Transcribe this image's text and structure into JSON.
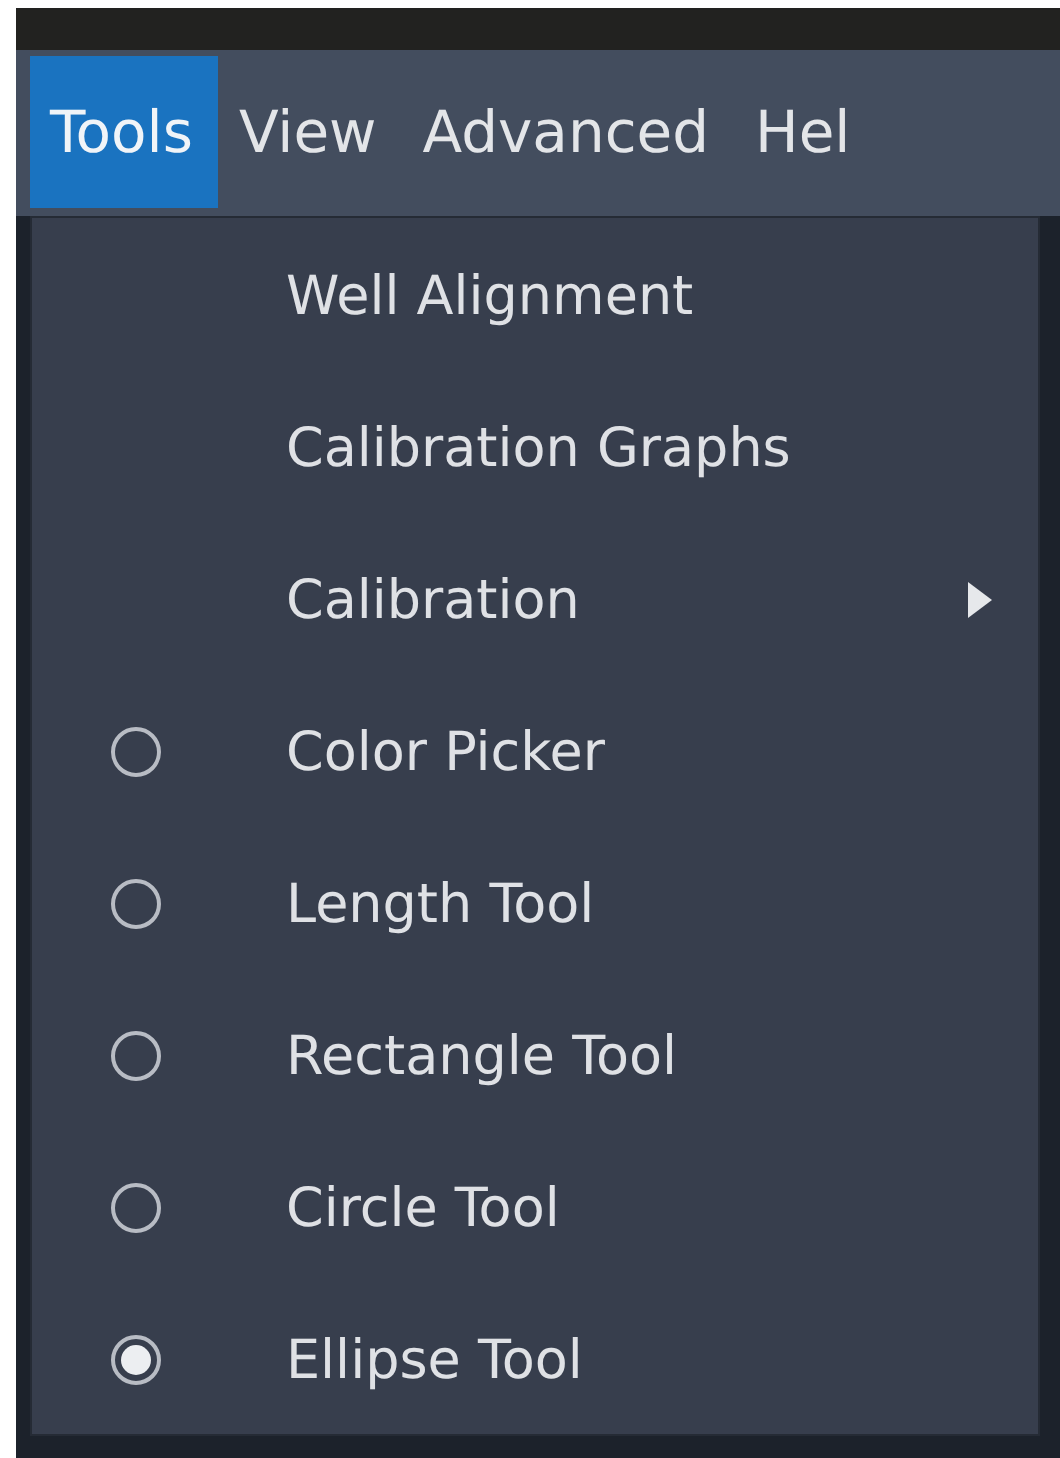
{
  "menubar": [
    {
      "label": "Tools",
      "selected": true
    },
    {
      "label": "View",
      "selected": false
    },
    {
      "label": "Advanced",
      "selected": false
    },
    {
      "label": "Hel",
      "selected": false
    }
  ],
  "menu": {
    "items": [
      {
        "kind": "action",
        "label": "Well Alignment"
      },
      {
        "kind": "action",
        "label": "Calibration Graphs"
      },
      {
        "kind": "submenu",
        "label": "Calibration"
      },
      {
        "kind": "radio",
        "label": "Color Picker",
        "checked": false
      },
      {
        "kind": "radio",
        "label": "Length Tool",
        "checked": false
      },
      {
        "kind": "radio",
        "label": "Rectangle Tool",
        "checked": false
      },
      {
        "kind": "radio",
        "label": "Circle Tool",
        "checked": false
      },
      {
        "kind": "radio",
        "label": "Ellipse Tool",
        "checked": true
      }
    ]
  }
}
